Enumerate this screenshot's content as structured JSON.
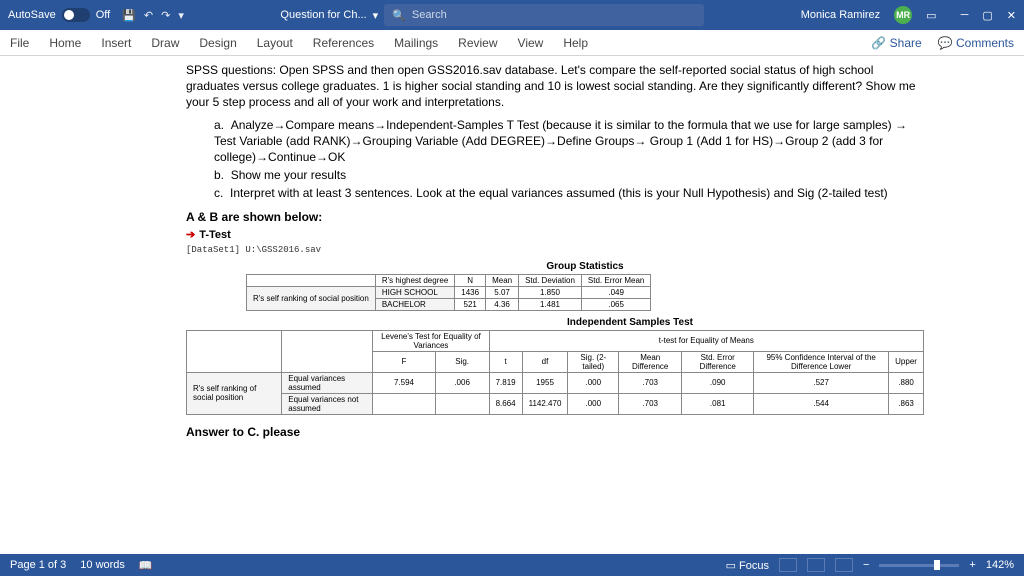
{
  "titlebar": {
    "autosave": "AutoSave",
    "off": "Off",
    "doc": "Question for Ch...",
    "searchPlaceholder": "Search",
    "user": "Monica Ramirez",
    "initials": "MR"
  },
  "ribbon": {
    "tabs": [
      "File",
      "Home",
      "Insert",
      "Draw",
      "Design",
      "Layout",
      "References",
      "Mailings",
      "Review",
      "View",
      "Help"
    ],
    "share": "Share",
    "comments": "Comments"
  },
  "body": {
    "intro": "SPSS questions: Open SPSS and then open GSS2016.sav database. Let's compare the self-reported social status of high school graduates versus college graduates. 1 is higher social standing and 10 is lowest social standing. Are they significantly different? Show me your 5 step process and all of your work and interpretations.",
    "a": "Analyze→Compare means→Independent-Samples T Test (because it is similar to the formula that we use for large samples) → Test Variable (add RANK)→Grouping Variable (Add DEGREE)→Define Groups→ Group 1 (Add 1 for HS)→Group 2 (add 3 for college)→Continue→OK",
    "b": "Show me your results",
    "c": "Interpret with at least 3 sentences. Look at the equal variances assumed (this is your Null Hypothesis) and Sig (2-tailed test)",
    "ab": "A & B are shown below:",
    "ttest": "T-Test",
    "dataset": "[DataSet1] U:\\GSS2016.sav",
    "gstats": "Group Statistics",
    "indep": "Independent Samples Test",
    "answerc": "Answer to C. please"
  },
  "chart_data": [
    {
      "type": "table",
      "title": "Group Statistics",
      "columns": [
        "",
        "R's highest degree",
        "N",
        "Mean",
        "Std. Deviation",
        "Std. Error Mean"
      ],
      "rows": [
        [
          "R's self ranking of social position",
          "HIGH SCHOOL",
          "1436",
          "5.07",
          "1.850",
          ".049"
        ],
        [
          "",
          "BACHELOR",
          "521",
          "4.36",
          "1.481",
          ".065"
        ]
      ]
    },
    {
      "type": "table",
      "title": "Independent Samples Test",
      "super_headers": [
        "",
        "Levene's Test for Equality of Variances",
        "t-test for Equality of Means"
      ],
      "columns": [
        "",
        "",
        "F",
        "Sig.",
        "t",
        "df",
        "Sig. (2-tailed)",
        "Mean Difference",
        "Std. Error Difference",
        "95% Confidence Interval of the Difference Lower",
        "Upper"
      ],
      "rows": [
        [
          "R's self ranking of social position",
          "Equal variances assumed",
          "7.594",
          ".006",
          "7.819",
          "1955",
          ".000",
          ".703",
          ".090",
          ".527",
          ".880"
        ],
        [
          "",
          "Equal variances not assumed",
          "",
          "",
          "8.664",
          "1142.470",
          ".000",
          ".703",
          ".081",
          ".544",
          ".863"
        ]
      ]
    }
  ],
  "status": {
    "page": "Page 1 of 3",
    "words": "10 words",
    "focus": "Focus",
    "zoom": "142%"
  }
}
